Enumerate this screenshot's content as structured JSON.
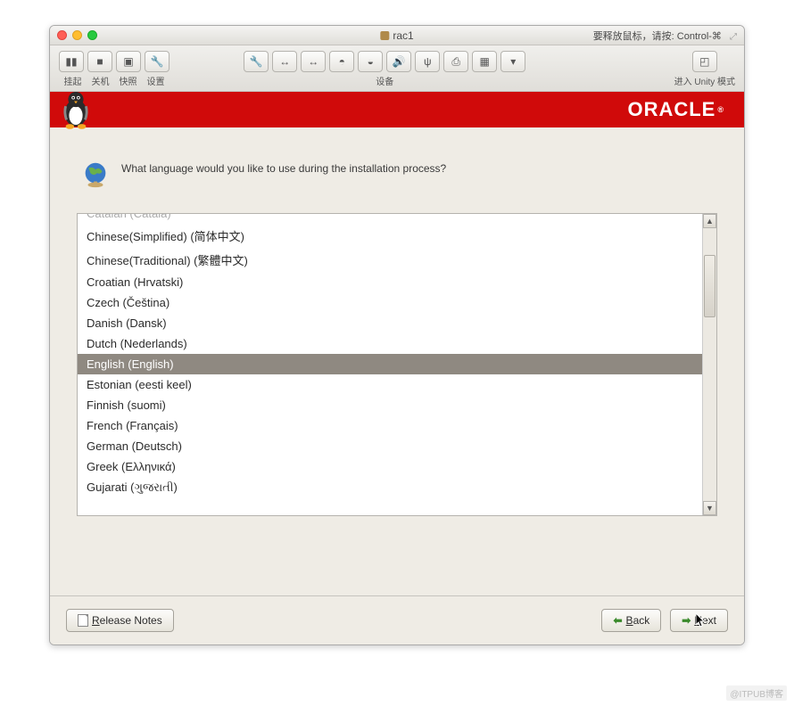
{
  "titlebar": {
    "title": "rac1",
    "right_hint": "要释放鼠标，请按: Control-⌘"
  },
  "toolbar": {
    "left": {
      "items": [
        {
          "icon": "▮▮",
          "name": "suspend-button"
        },
        {
          "icon": "■",
          "name": "poweroff-button"
        },
        {
          "icon": "▣",
          "name": "snapshot-button"
        },
        {
          "icon": "🔧",
          "name": "settings-button"
        }
      ],
      "labels": [
        "挂起",
        "关机",
        "快照",
        "设置"
      ]
    },
    "center": {
      "items": [
        {
          "icon": "🔧",
          "name": "tools-icon"
        },
        {
          "icon": "↔",
          "name": "network1-icon"
        },
        {
          "icon": "↔",
          "name": "network2-icon"
        },
        {
          "icon": "◓",
          "name": "disk-icon"
        },
        {
          "icon": "◒",
          "name": "cd-icon"
        },
        {
          "icon": "🔊",
          "name": "sound-icon"
        },
        {
          "icon": "ψ",
          "name": "usb-icon"
        },
        {
          "icon": "⎙",
          "name": "printer-icon"
        },
        {
          "icon": "▦",
          "name": "shared-icon"
        },
        {
          "icon": "▾",
          "name": "more-icon"
        }
      ],
      "label": "设备"
    },
    "right": {
      "icon": "◰",
      "label": "进入 Unity 模式"
    }
  },
  "banner": {
    "logo_text": "ORACLE"
  },
  "prompt": "What language would you like to use during the installation process?",
  "languages": [
    {
      "label": "Catalan (Català)",
      "cut": true
    },
    {
      "label": "Chinese(Simplified) (简体中文)"
    },
    {
      "label": "Chinese(Traditional) (繁體中文)"
    },
    {
      "label": "Croatian (Hrvatski)"
    },
    {
      "label": "Czech (Čeština)"
    },
    {
      "label": "Danish (Dansk)"
    },
    {
      "label": "Dutch (Nederlands)"
    },
    {
      "label": "English (English)",
      "selected": true
    },
    {
      "label": "Estonian (eesti keel)"
    },
    {
      "label": "Finnish (suomi)"
    },
    {
      "label": "French (Français)"
    },
    {
      "label": "German (Deutsch)"
    },
    {
      "label": "Greek (Ελληνικά)"
    },
    {
      "label": "Gujarati (ગુજરાતી)"
    }
  ],
  "footer": {
    "release_notes": "elease Notes",
    "release_notes_mnemonic": "R",
    "back": "ack",
    "back_mnemonic": "B",
    "next": "ext",
    "next_mnemonic": "N"
  },
  "watermark": "@ITPUB博客"
}
